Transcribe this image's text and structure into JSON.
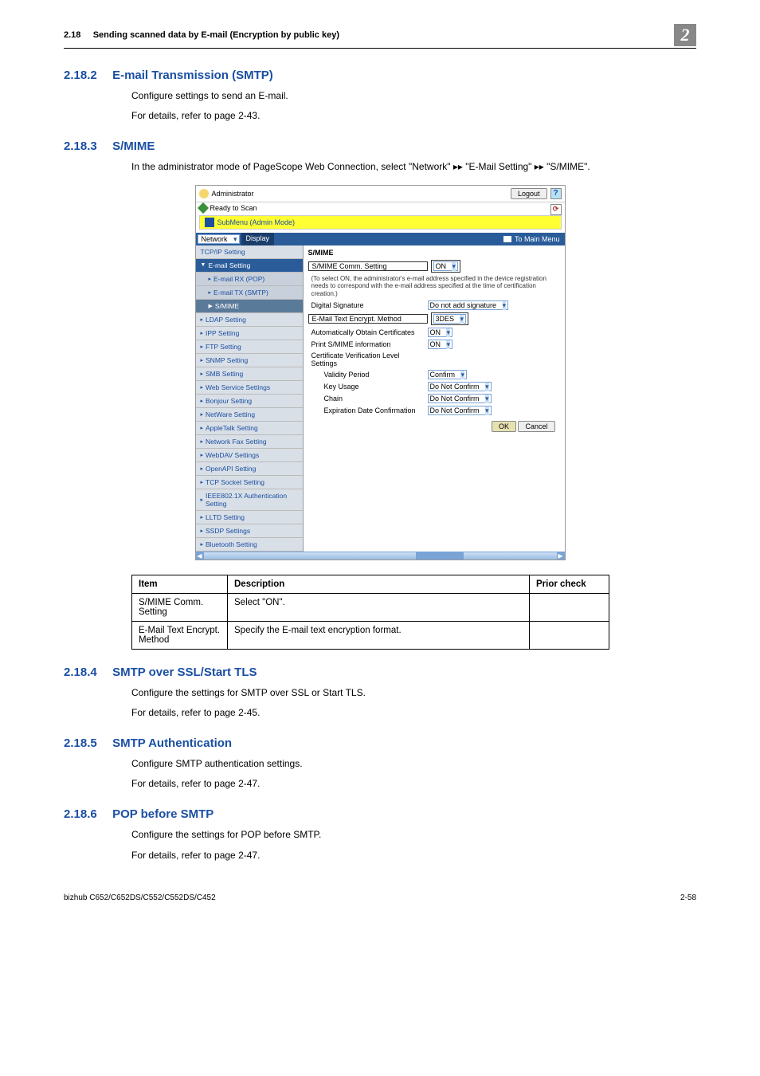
{
  "header": {
    "section_num": "2.18",
    "section_title": "Sending scanned data by E-mail (Encryption by public key)",
    "chapter_badge": "2"
  },
  "sections": [
    {
      "num": "2.18.2",
      "title": "E-mail Transmission (SMTP)",
      "paras": [
        "Configure settings to send an E-mail.",
        "For details, refer to page 2-43."
      ]
    },
    {
      "num": "2.18.3",
      "title": "S/MIME",
      "paras": [
        "In the administrator mode of PageScope Web Connection, select \"Network\" ▸▸ \"E-Mail Setting\" ▸▸ \"S/MIME\"."
      ]
    },
    {
      "num": "2.18.4",
      "title": "SMTP over SSL/Start TLS",
      "paras": [
        "Configure the settings for SMTP over SSL or Start TLS.",
        "For details, refer to page 2-45."
      ]
    },
    {
      "num": "2.18.5",
      "title": "SMTP Authentication",
      "paras": [
        "Configure SMTP authentication settings.",
        "For details, refer to page 2-47."
      ]
    },
    {
      "num": "2.18.6",
      "title": "POP before SMTP",
      "paras": [
        "Configure the settings for POP before SMTP.",
        "For details, refer to page 2-47."
      ]
    }
  ],
  "screenshot": {
    "administrator": "Administrator",
    "logout": "Logout",
    "help": "?",
    "ready": "Ready to Scan",
    "submenu": "SubMenu (Admin Mode)",
    "network_dd": "Network",
    "display": "Display",
    "to_main_menu": "To Main Menu",
    "nav": [
      {
        "t": "TCP/IP Setting",
        "cls": ""
      },
      {
        "t": "E-mail Setting",
        "cls": "expanded",
        "pre": "▼"
      },
      {
        "t": "E-mail RX (POP)",
        "cls": "sub",
        "pre": "▸"
      },
      {
        "t": "E-mail TX (SMTP)",
        "cls": "sub",
        "pre": "▸"
      },
      {
        "t": "S/MIME",
        "cls": "activesub",
        "pre": "▶"
      },
      {
        "t": "LDAP Setting",
        "cls": "",
        "pre": "▸"
      },
      {
        "t": "IPP Setting",
        "cls": "",
        "pre": "▸"
      },
      {
        "t": "FTP Setting",
        "cls": "",
        "pre": "▸"
      },
      {
        "t": "SNMP Setting",
        "cls": "",
        "pre": "▸"
      },
      {
        "t": "SMB Setting",
        "cls": "",
        "pre": "▸"
      },
      {
        "t": "Web Service Settings",
        "cls": "",
        "pre": "▸"
      },
      {
        "t": "Bonjour Setting",
        "cls": "",
        "pre": "▸"
      },
      {
        "t": "NetWare Setting",
        "cls": "",
        "pre": "▸"
      },
      {
        "t": "AppleTalk Setting",
        "cls": "",
        "pre": "▸"
      },
      {
        "t": "Network Fax Setting",
        "cls": "",
        "pre": "▸"
      },
      {
        "t": "WebDAV Settings",
        "cls": "",
        "pre": "▸"
      },
      {
        "t": "OpenAPI Setting",
        "cls": "",
        "pre": "▸"
      },
      {
        "t": "TCP Socket Setting",
        "cls": "",
        "pre": "▸"
      },
      {
        "t": "IEEE802.1X Authentication Setting",
        "cls": "",
        "pre": "▸"
      },
      {
        "t": "LLTD Setting",
        "cls": "",
        "pre": "▸"
      },
      {
        "t": "SSDP Settings",
        "cls": "",
        "pre": "▸"
      },
      {
        "t": "Bluetooth Setting",
        "cls": "",
        "pre": "▸"
      }
    ],
    "main_heading": "S/MIME",
    "rows": [
      {
        "label": "S/MIME Comm. Setting",
        "value": "ON",
        "boxed": true
      },
      {
        "note": "(To select ON, the administrator's e-mail address specified in the device registration needs to correspond with the e-mail address specified at the time of certification creation.)"
      },
      {
        "label": "Digital Signature",
        "value": "Do not add signature"
      },
      {
        "label": "E-Mail Text Encrypt. Method",
        "value": "3DES",
        "boxed": true
      },
      {
        "label": "Automatically Obtain Certificates",
        "value": "ON"
      },
      {
        "label": "Print S/MIME information",
        "value": "ON"
      },
      {
        "label": "Certificate Verification Level Settings",
        "header": true
      },
      {
        "label": "Validity Period",
        "value": "Confirm",
        "sub": true
      },
      {
        "label": "Key Usage",
        "value": "Do Not Confirm",
        "sub": true
      },
      {
        "label": "Chain",
        "value": "Do Not Confirm",
        "sub": true
      },
      {
        "label": "Expiration Date Confirmation",
        "value": "Do Not Confirm",
        "sub": true
      }
    ],
    "ok": "OK",
    "cancel": "Cancel"
  },
  "table": {
    "headers": [
      "Item",
      "Description",
      "Prior check"
    ],
    "rows": [
      [
        "S/MIME Comm. Setting",
        "Select \"ON\".",
        ""
      ],
      [
        "E-Mail Text Encrypt. Method",
        "Specify the E-mail text encryption format.",
        ""
      ]
    ]
  },
  "footer": {
    "left": "bizhub C652/C652DS/C552/C552DS/C452",
    "right": "2-58"
  }
}
